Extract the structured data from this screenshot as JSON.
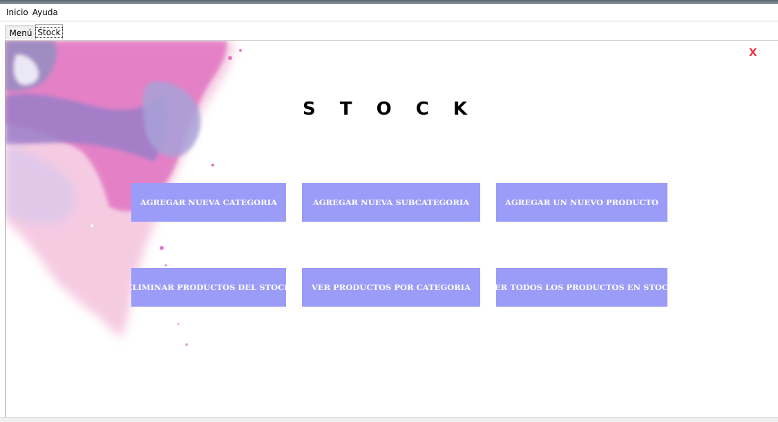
{
  "menubar": {
    "items": [
      "Inicio",
      "Ayuda"
    ]
  },
  "tabs": {
    "items": [
      "Menú",
      "Stock"
    ],
    "active": "Stock"
  },
  "stock_page": {
    "close_label": "X",
    "title": "S T O C K",
    "buttons": [
      "AGREGAR NUEVA CATEGORIA",
      "AGREGAR NUEVA SUBCATEGORIA",
      "AGREGAR UN NUEVO  PRODUCTO",
      "ELIMINAR PRODUCTOS DEL STOCK",
      "VER PRODUCTOS POR CATEGORIA",
      "VER TODOS LOS PRODUCTOS EN STOCK"
    ]
  },
  "colors": {
    "button_bg": "#9b9bf8",
    "button_text": "#ffffff",
    "close": "#e8363d",
    "title": "#000000"
  }
}
